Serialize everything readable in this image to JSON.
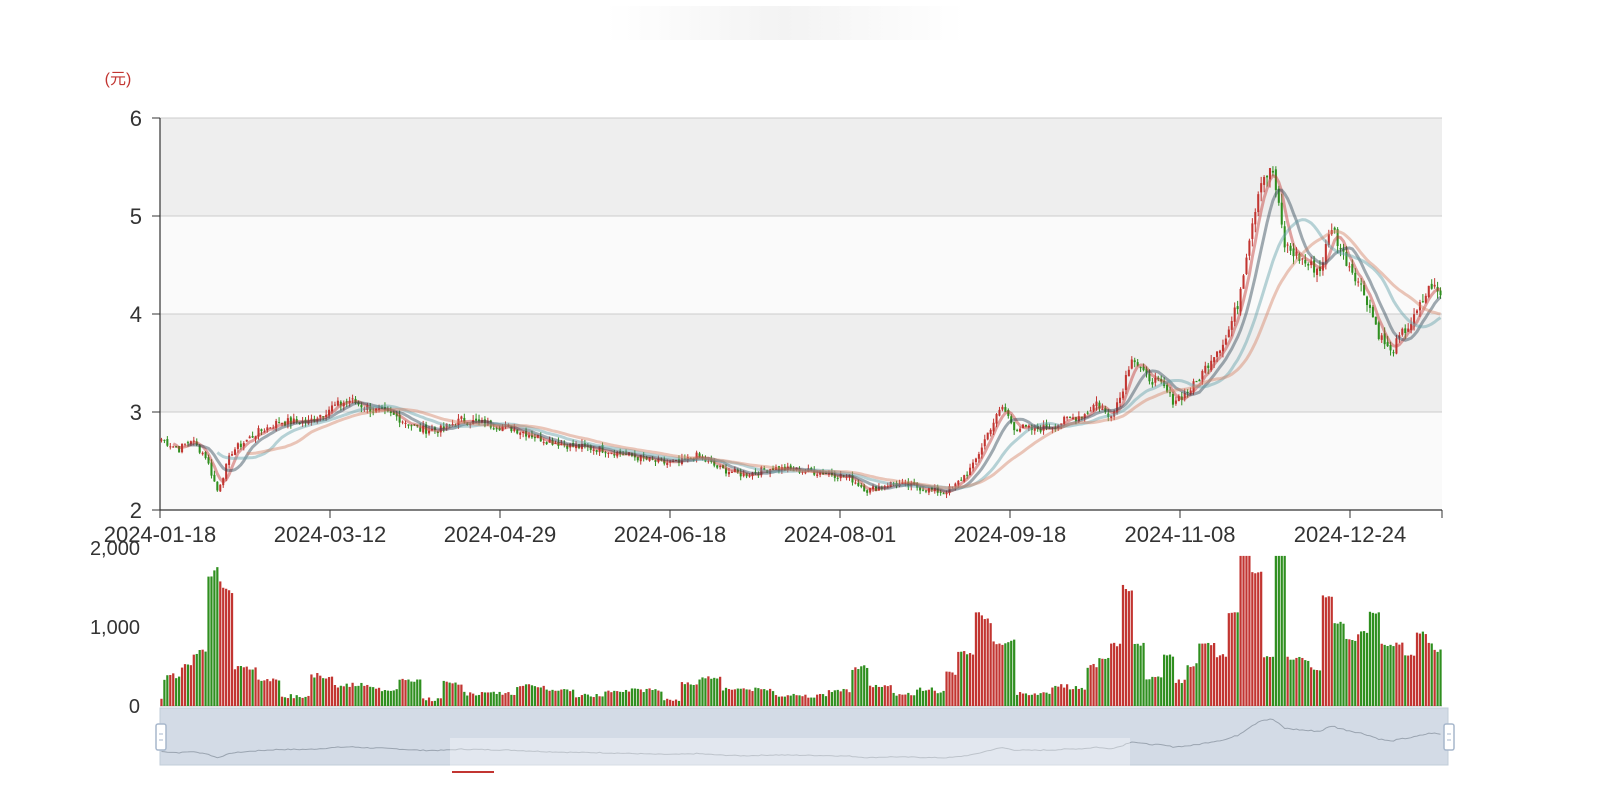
{
  "chart_data": {
    "type": "candlestick",
    "unit_label": "(元)",
    "y_ticks": [
      2,
      3,
      4,
      5,
      6
    ],
    "ylim": [
      2,
      6
    ],
    "x_tick_labels": [
      "2024-01-18",
      "2024-03-12",
      "2024-04-29",
      "2024-06-18",
      "2024-08-01",
      "2024-09-18",
      "2024-11-08",
      "2024-12-24"
    ],
    "volume_ticks": [
      "0",
      "1,000",
      "2,000"
    ],
    "volume_ylim": [
      0,
      2000
    ],
    "price_close_anchors": [
      [
        0,
        2.72
      ],
      [
        6,
        2.62
      ],
      [
        10,
        2.72
      ],
      [
        15,
        2.55
      ],
      [
        19,
        2.2
      ],
      [
        24,
        2.6
      ],
      [
        32,
        2.78
      ],
      [
        40,
        2.9
      ],
      [
        50,
        2.9
      ],
      [
        58,
        3.05
      ],
      [
        64,
        3.12
      ],
      [
        72,
        3.02
      ],
      [
        80,
        2.95
      ],
      [
        88,
        2.82
      ],
      [
        95,
        2.82
      ],
      [
        102,
        2.92
      ],
      [
        110,
        2.88
      ],
      [
        120,
        2.83
      ],
      [
        130,
        2.72
      ],
      [
        140,
        2.65
      ],
      [
        150,
        2.62
      ],
      [
        160,
        2.55
      ],
      [
        170,
        2.48
      ],
      [
        176,
        2.48
      ],
      [
        182,
        2.55
      ],
      [
        190,
        2.42
      ],
      [
        198,
        2.36
      ],
      [
        208,
        2.43
      ],
      [
        218,
        2.4
      ],
      [
        226,
        2.38
      ],
      [
        234,
        2.33
      ],
      [
        240,
        2.2
      ],
      [
        248,
        2.27
      ],
      [
        256,
        2.24
      ],
      [
        262,
        2.2
      ],
      [
        266,
        2.18
      ],
      [
        270,
        2.25
      ],
      [
        276,
        2.45
      ],
      [
        282,
        2.85
      ],
      [
        286,
        3.05
      ],
      [
        290,
        2.85
      ],
      [
        296,
        2.82
      ],
      [
        302,
        2.85
      ],
      [
        308,
        2.92
      ],
      [
        314,
        2.98
      ],
      [
        318,
        3.1
      ],
      [
        322,
        2.95
      ],
      [
        326,
        3.15
      ],
      [
        330,
        3.58
      ],
      [
        334,
        3.38
      ],
      [
        340,
        3.28
      ],
      [
        344,
        3.12
      ],
      [
        348,
        3.18
      ],
      [
        352,
        3.3
      ],
      [
        358,
        3.6
      ],
      [
        362,
        3.75
      ],
      [
        366,
        4.1
      ],
      [
        370,
        4.8
      ],
      [
        374,
        5.4
      ],
      [
        378,
        5.45
      ],
      [
        382,
        4.7
      ],
      [
        386,
        4.6
      ],
      [
        390,
        4.5
      ],
      [
        394,
        4.45
      ],
      [
        398,
        4.9
      ],
      [
        402,
        4.6
      ],
      [
        406,
        4.4
      ],
      [
        410,
        4.15
      ],
      [
        414,
        3.8
      ],
      [
        418,
        3.6
      ],
      [
        422,
        3.8
      ],
      [
        426,
        3.95
      ],
      [
        430,
        4.2
      ],
      [
        432,
        4.3
      ],
      [
        435,
        4.18
      ]
    ],
    "moving_averages": [
      {
        "window": 5,
        "color": "#c23531"
      },
      {
        "window": 10,
        "color": "#2f4554"
      },
      {
        "window": 20,
        "color": "#61a0a8"
      },
      {
        "window": 30,
        "color": "#d48265"
      }
    ],
    "up_color": "#c23531",
    "down_color": "#2f8f1f",
    "background_bands": [
      "#fafafa",
      "#eeeeee"
    ]
  }
}
